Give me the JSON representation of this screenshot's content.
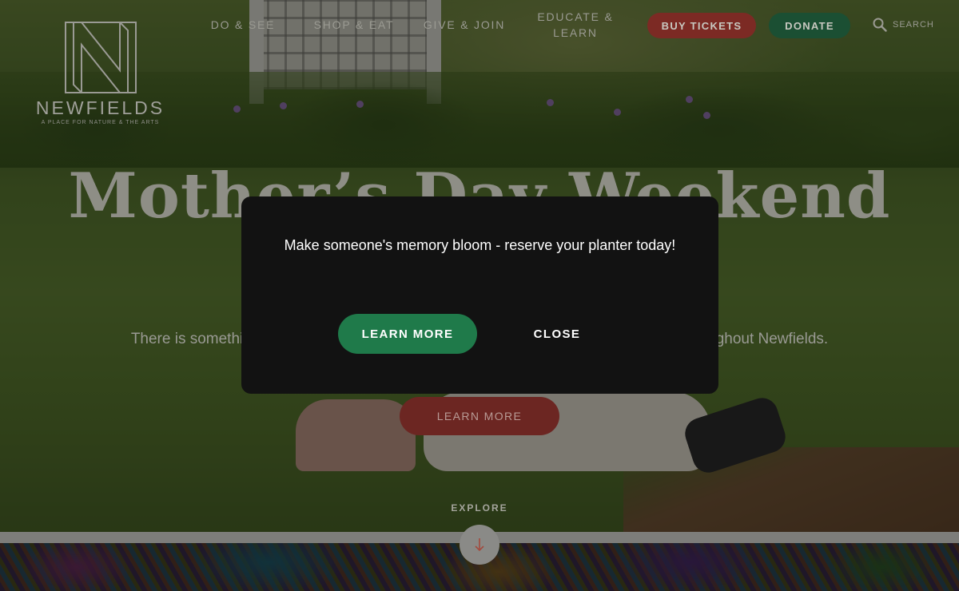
{
  "brand": {
    "name": "NEWFIELDS",
    "tagline": "A PLACE FOR NATURE & THE ARTS"
  },
  "nav": {
    "items": [
      {
        "label": "DO & SEE"
      },
      {
        "label": "SHOP & EAT"
      },
      {
        "label": "GIVE & JOIN"
      },
      {
        "label_line1": "EDUCATE &",
        "label_line2": "LEARN"
      }
    ],
    "buy_tickets": "BUY TICKETS",
    "donate": "DONATE",
    "search": "SEARCH"
  },
  "hero": {
    "title": "Mother’s Day Weekend",
    "text": "There is something for mom this weekend with special dining, art, nature, and fun throughout Newfields.",
    "button": "LEARN MORE"
  },
  "explore": {
    "label": "EXPLORE",
    "icon": "arrow-down-icon"
  },
  "modal": {
    "message": "Make someone's memory bloom - reserve your planter today!",
    "learn_more": "LEARN MORE",
    "close": "CLOSE"
  },
  "colors": {
    "buy_tickets_bg": "#7c2a24",
    "donate_bg": "#1b4f33",
    "modal_bg": "#121212",
    "modal_learn_bg": "#1f7a4a"
  }
}
